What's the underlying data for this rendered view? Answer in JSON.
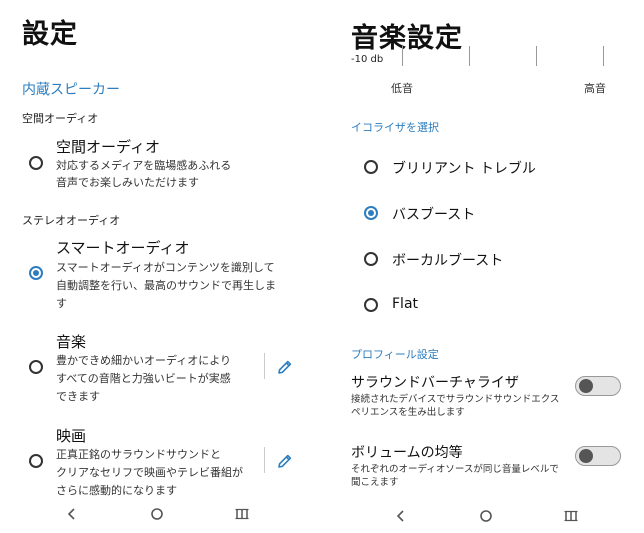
{
  "left": {
    "title": "設定",
    "section_link": "内蔵スピーカー",
    "spatial_group": "空間オーディオ",
    "spatial": {
      "title": "空間オーディオ",
      "desc1": "対応するメディアを臨場感あふれる",
      "desc2": "音声でお楽しみいただけます"
    },
    "stereo_group": "ステレオオーディオ",
    "smart": {
      "title": "スマートオーディオ",
      "desc1": "スマートオーディオがコンテンツを識別して",
      "desc2": "自動調整を行い、最高のサウンドで再生しま",
      "desc3": "す"
    },
    "music": {
      "title": "音楽",
      "desc1": "豊かできめ細かいオーディオにより",
      "desc2": "すべての音階と力強いビートが実感",
      "desc3": "できます"
    },
    "movie": {
      "title": "映画",
      "desc1": "正真正銘のサラウンドサウンドと",
      "desc2": "クリアなセリフで映画やテレビ番組が",
      "desc3": "さらに感動的になります"
    }
  },
  "right": {
    "title": "音楽設定",
    "db_label": "-10 db",
    "low_label": "低音",
    "high_label": "高音",
    "eq_section": "イコライザを選択",
    "eq_options": [
      "ブリリアント トレブル",
      "バスブースト",
      "ボーカルブースト",
      "Flat"
    ],
    "eq_selected": 1,
    "profile_section": "プロフィール設定",
    "surround": {
      "title": "サラウンドバーチャライザ",
      "desc1": "接続されたデバイスでサラウンドサウンドエクス",
      "desc2": "ペリエンスを生み出します",
      "enabled": false
    },
    "volume_eq": {
      "title": "ボリュームの均等",
      "desc1": "それぞれのオーディオソースが同じ音量レベルで",
      "desc2": "聞こえます",
      "enabled": false
    }
  },
  "icons": {
    "edit": "pencil-icon",
    "back": "back-chevron-icon",
    "home": "home-circle-icon",
    "recents": "recents-icon"
  },
  "colors": {
    "accent": "#2d7dbf",
    "text": "#111111"
  }
}
